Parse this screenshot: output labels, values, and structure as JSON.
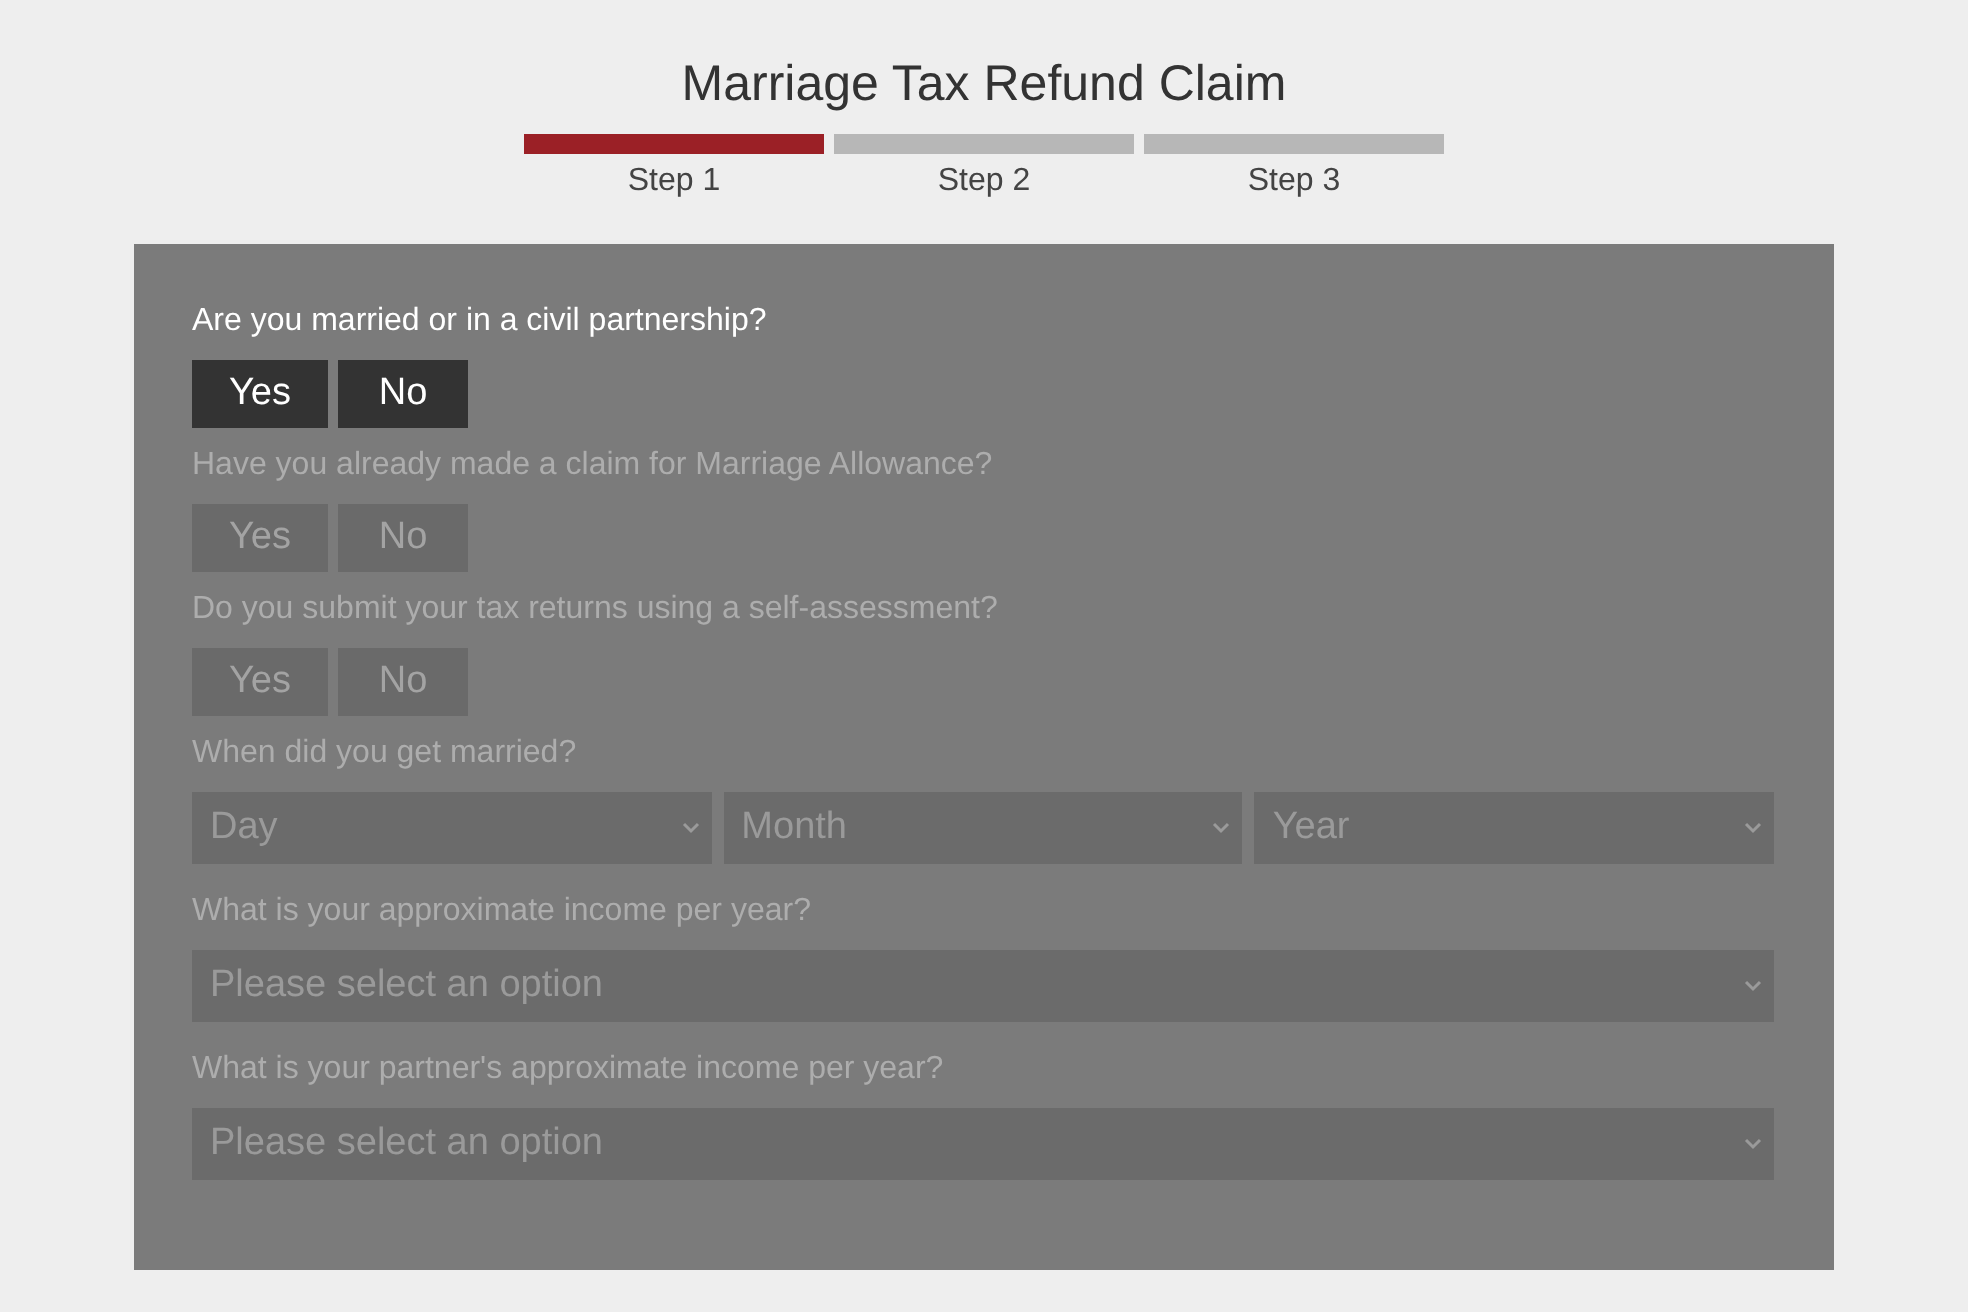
{
  "title": "Marriage Tax Refund Claim",
  "steps": [
    {
      "label": "Step 1",
      "selected": true
    },
    {
      "label": "Step 2",
      "selected": false
    },
    {
      "label": "Step 3",
      "selected": false
    }
  ],
  "questions": [
    {
      "kind": "yesno",
      "label": "Are you married or in a civil partnership?",
      "disabled": false,
      "options": [
        "Yes",
        "No"
      ]
    },
    {
      "kind": "yesno",
      "label": "Have you already made a claim for Marriage Allowance?",
      "disabled": true,
      "options": [
        "Yes",
        "No"
      ]
    },
    {
      "kind": "yesno",
      "label": "Do you submit your tax returns using a self-assessment?",
      "disabled": true,
      "options": [
        "Yes",
        "No"
      ]
    },
    {
      "kind": "select",
      "label": "When did you get married?",
      "disabled": true,
      "options": [
        "Day",
        "Month",
        "Year"
      ]
    },
    {
      "kind": "select",
      "label": "What is your approximate income per year?",
      "disabled": true,
      "options": [
        "Please select an option"
      ]
    },
    {
      "kind": "select",
      "label": "What is your partner's approximate income per year?",
      "disabled": true,
      "options": [
        "Please select an option"
      ]
    }
  ]
}
